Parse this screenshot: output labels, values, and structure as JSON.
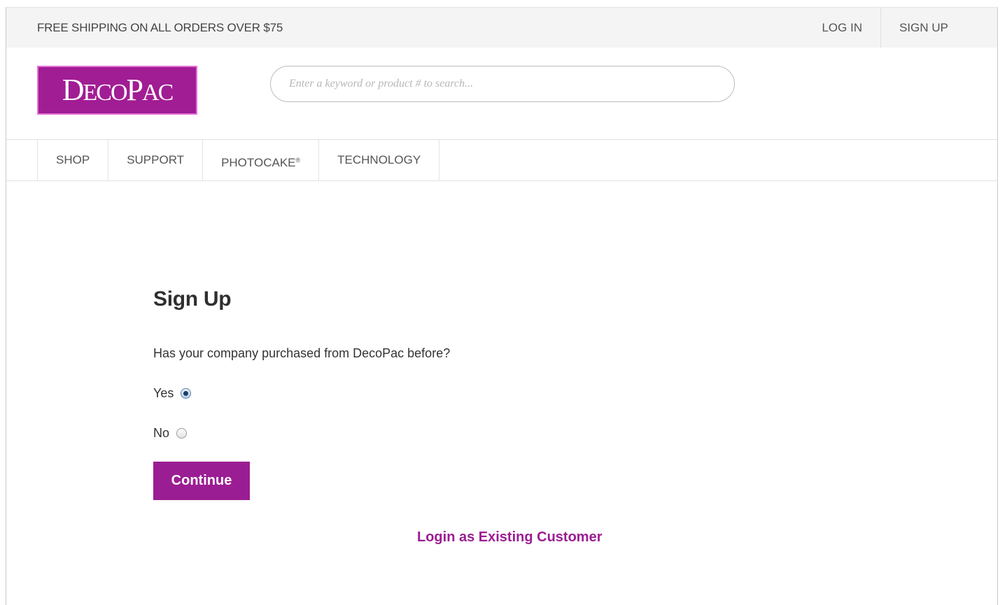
{
  "promo": {
    "text": "FREE SHIPPING ON ALL ORDERS OVER $75"
  },
  "account": {
    "login_label": "LOG IN",
    "signup_label": "SIGN UP"
  },
  "logo": {
    "text_d": "D",
    "text_eco": "ECO",
    "text_p": "P",
    "text_ac": "AC",
    "color": "#a11d94"
  },
  "search": {
    "placeholder": "Enter a keyword or product # to search...",
    "value": ""
  },
  "nav": {
    "items": [
      {
        "label": "SHOP"
      },
      {
        "label": "SUPPORT"
      },
      {
        "label": "PHOTOCAKE",
        "sup": "®"
      },
      {
        "label": "TECHNOLOGY"
      }
    ]
  },
  "signup": {
    "title": "Sign Up",
    "question": "Has your company purchased from DecoPac before?",
    "options": [
      {
        "label": "Yes",
        "checked": true
      },
      {
        "label": "No",
        "checked": false
      }
    ],
    "continue_label": "Continue",
    "existing_link": "Login as Existing Customer"
  },
  "colors": {
    "brand_purple": "#9b1d93",
    "promo_bg": "#f4f4f5"
  }
}
